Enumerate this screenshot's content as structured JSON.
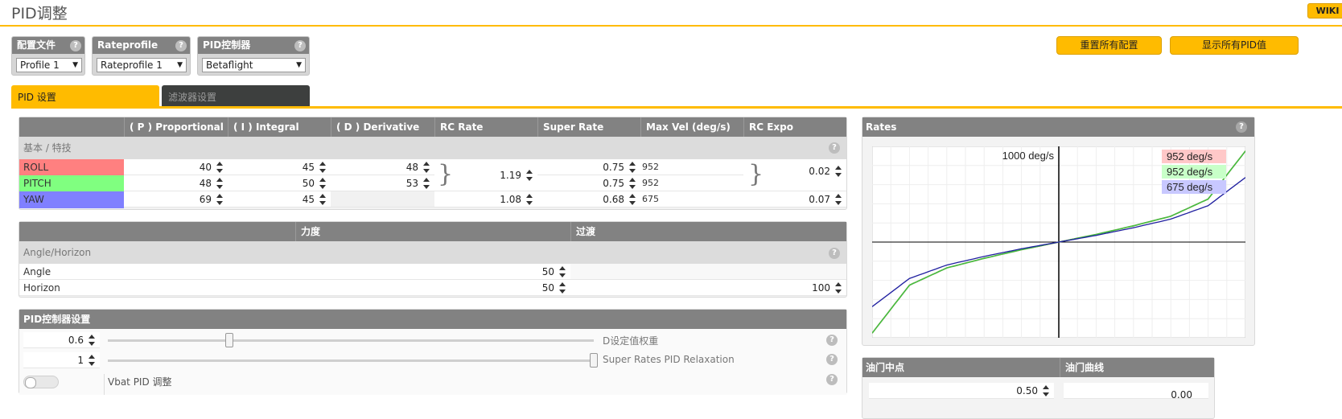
{
  "page": {
    "title": "PID调整",
    "wiki": "WIKI"
  },
  "selectors": [
    {
      "label": "配置文件",
      "value": "Profile 1"
    },
    {
      "label": "Rateprofile",
      "value": "Rateprofile 1"
    },
    {
      "label": "PID控制器",
      "value": "Betaflight"
    }
  ],
  "actions": {
    "reset": "重置所有配置",
    "show_all": "显示所有PID值"
  },
  "tabs": [
    {
      "label": "PID 设置",
      "active": true
    },
    {
      "label": "滤波器设置",
      "active": false
    }
  ],
  "pid_table": {
    "headers": [
      "",
      "( P ) Proportional",
      "( I ) Integral",
      "( D ) Derivative",
      "RC Rate",
      "Super Rate",
      "Max Vel (deg/s)",
      "RC Expo"
    ],
    "section": "基本 / 特技",
    "rows": [
      {
        "name": "ROLL",
        "color": "#ff8080",
        "p": "40",
        "i": "45",
        "d": "48",
        "rc_rate": "1.19",
        "super_rate": "0.75",
        "max_vel": "952",
        "rc_expo": "0.02"
      },
      {
        "name": "PITCH",
        "color": "#80ff80",
        "p": "48",
        "i": "50",
        "d": "53",
        "rc_rate": "",
        "super_rate": "0.75",
        "max_vel": "952",
        "rc_expo": ""
      },
      {
        "name": "YAW",
        "color": "#8080ff",
        "p": "69",
        "i": "45",
        "d": "",
        "rc_rate": "1.08",
        "super_rate": "0.68",
        "max_vel": "675",
        "rc_expo": "0.07"
      }
    ]
  },
  "angle_table": {
    "headers": [
      "",
      "力度",
      "过渡"
    ],
    "section": "Angle/Horizon",
    "rows": [
      {
        "name": "Angle",
        "strength": "50",
        "transition": ""
      },
      {
        "name": "Horizon",
        "strength": "50",
        "transition": "100"
      }
    ]
  },
  "controller_settings": {
    "title": "PID控制器设置",
    "d_setpoint": {
      "value": "0.6",
      "label": "D设定值权重",
      "level": 0.25
    },
    "relaxation": {
      "value": "1",
      "label": "Super Rates PID Relaxation",
      "level": 1.0
    },
    "vbat": {
      "label": "Vbat PID 调整",
      "enabled": false
    }
  },
  "rates_panel": {
    "title": "Rates",
    "top_label": "1000 deg/s",
    "legend": [
      {
        "label": "952 deg/s",
        "color": "#ffc8c8"
      },
      {
        "label": "952 deg/s",
        "color": "#c8ffc8"
      },
      {
        "label": "675 deg/s",
        "color": "#c8c8ff"
      }
    ]
  },
  "throttle_table": {
    "headers": [
      "油门中点",
      "油门曲线"
    ],
    "mid_value": "0.50",
    "expo_value": "0.00"
  },
  "chart_data": {
    "type": "line",
    "title": "",
    "x": [
      -1,
      -0.8,
      -0.6,
      -0.4,
      -0.2,
      0,
      0.2,
      0.4,
      0.6,
      0.8,
      1
    ],
    "series": [
      {
        "color": "#ff6060",
        "values": [
          -952,
          -450,
          -270,
          -170,
          -80,
          0,
          80,
          170,
          270,
          450,
          952
        ]
      },
      {
        "color": "#40c040",
        "values": [
          -952,
          -450,
          -270,
          -170,
          -80,
          0,
          80,
          170,
          270,
          450,
          952
        ]
      },
      {
        "color": "#2020a0",
        "values": [
          -675,
          -380,
          -240,
          -150,
          -70,
          0,
          70,
          150,
          240,
          380,
          675
        ]
      }
    ],
    "xlim": [
      -1,
      1
    ],
    "ylim": [
      -1000,
      1000
    ],
    "grid": true
  },
  "colors": {
    "accent": "#ffbb00",
    "header": "#828282",
    "dark_tab": "#3d3f3e"
  }
}
